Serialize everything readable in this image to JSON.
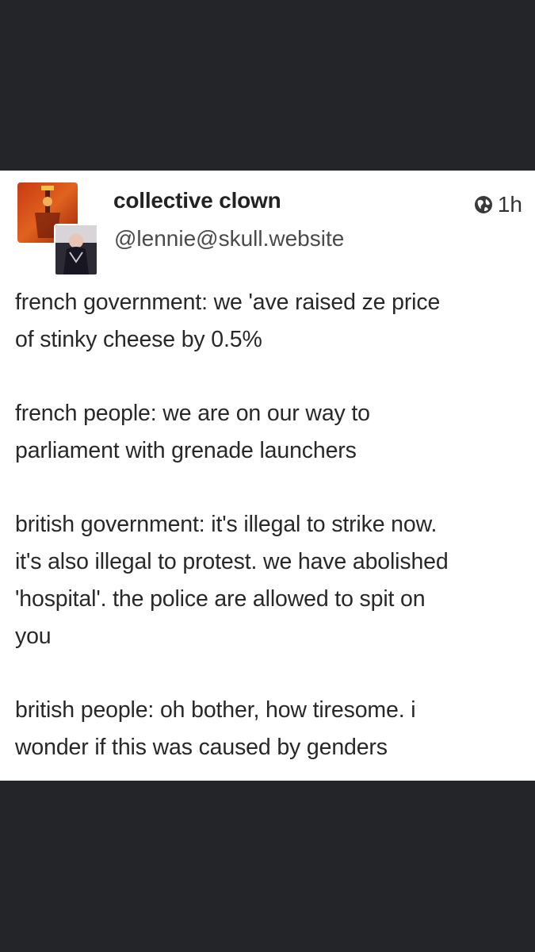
{
  "post": {
    "display_name": "collective clown",
    "handle": "@lennie@skull.website",
    "time": "1h",
    "visibility_icon": "globe-icon",
    "avatar_icon": "avatar-image",
    "paragraphs": [
      "french government: we 'ave raised ze price\nof stinky cheese by 0.5%",
      "french people: we are on our way to\nparliament with grenade launchers",
      "british government: it's illegal to strike now.\nit's also illegal to protest. we have abolished\n'hospital'. the police are allowed to spit on\nyou",
      "british people: oh bother, how tiresome. i\nwonder if this was caused by genders"
    ]
  },
  "colors": {
    "page_background": "#242528",
    "card_background": "#ffffff",
    "text": "#282828"
  }
}
